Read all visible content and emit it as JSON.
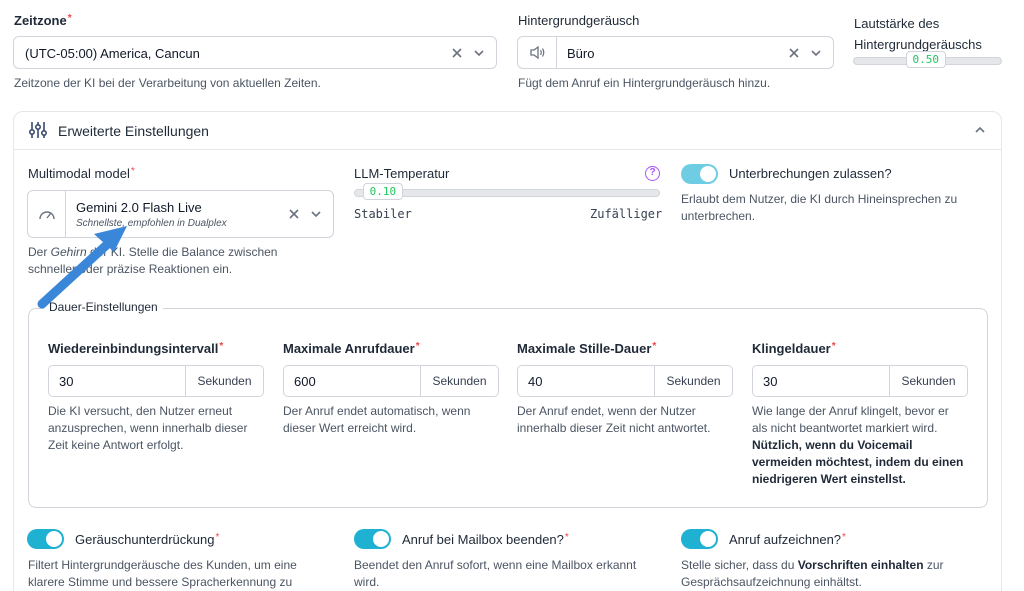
{
  "timezone": {
    "label": "Zeitzone",
    "value": "(UTC-05:00) America, Cancun",
    "help": "Zeitzone der KI bei der Verarbeitung von aktuellen Zeiten."
  },
  "background_noise": {
    "label": "Hintergrundgeräusch",
    "value": "Büro",
    "help": "Fügt dem Anruf ein Hintergrundgeräusch hinzu."
  },
  "noise_volume": {
    "label_line1": "Lautstärke des",
    "label_line2": "Hintergrundgeräuschs",
    "value": "0.50",
    "level": 0.5
  },
  "advanced": {
    "title": "Erweiterte Einstellungen"
  },
  "model": {
    "label": "Multimodal model",
    "value": "Gemini 2.0 Flash Live",
    "subvalue": "Schnellste, empfohlen in Dualplex",
    "help_a": "Der ",
    "help_em": "Gehirn",
    "help_b": " der KI. Stelle die Balance zwischen",
    "help_line2": "schneller oder präzise Reaktionen ein."
  },
  "llm_temperature": {
    "label": "LLM-Temperatur",
    "value": "0.10",
    "level": 0.1,
    "left_label": "Stabiler",
    "right_label": "Zufälliger",
    "help_icon": "?"
  },
  "interruptions": {
    "label": "Unterbrechungen zulassen?",
    "help_line1": "Erlaubt dem Nutzer, die KI durch Hineinsprechen zu",
    "help_line2": "unterbrechen.",
    "enabled": true
  },
  "duration": {
    "legend": "Dauer-Einstellungen",
    "fields": [
      {
        "label": "Wiedereinbindungsintervall",
        "value": "30",
        "unit": "Sekunden",
        "help_lines": [
          "Die KI versucht, den Nutzer erneut",
          "anzusprechen, wenn innerhalb dieser",
          "Zeit keine Antwort erfolgt."
        ]
      },
      {
        "label": "Maximale Anrufdauer",
        "value": "600",
        "unit": "Sekunden",
        "help_lines": [
          "Der Anruf endet automatisch, wenn",
          "dieser Wert erreicht wird."
        ]
      },
      {
        "label": "Maximale Stille-Dauer",
        "value": "40",
        "unit": "Sekunden",
        "help_lines": [
          "Der Anruf endet, wenn der Nutzer",
          "innerhalb dieser Zeit nicht antwortet."
        ]
      },
      {
        "label": "Klingeldauer",
        "value": "30",
        "unit": "Sekunden",
        "help_lines": [
          "Wie lange der Anruf klingelt, bevor er",
          "als nicht beantwortet markiert wird."
        ],
        "help_bold_lines": [
          "Nützlich, wenn du Voicemail",
          "vermeiden möchtest, indem du einen",
          "niedrigeren Wert einstellst."
        ]
      }
    ]
  },
  "noise_suppression": {
    "label": "Geräuschunterdrückung",
    "help_line1": "Filtert Hintergrundgeräusche des Kunden, um eine",
    "help_line2": "klarere Stimme und bessere Spracherkennung zu",
    "enabled": true
  },
  "end_on_mailbox": {
    "label": "Anruf bei Mailbox beenden?",
    "help_line1": "Beendet den Anruf sofort, wenn eine Mailbox erkannt",
    "help_line2": "wird.",
    "enabled": true
  },
  "record_call": {
    "label": "Anruf aufzeichnen?",
    "help_a": "Stelle sicher, dass du ",
    "help_bold": "Vorschriften einhalten",
    "help_b": " zur",
    "help_line2": "Gesprächsaufzeichnung einhältst.",
    "enabled": true
  },
  "colors": {
    "accent": "#1eb1d2",
    "arrow": "#3a86d9",
    "required": "#ef4444",
    "slider_value": "#22c55e",
    "help_icon": "#a855f7"
  }
}
